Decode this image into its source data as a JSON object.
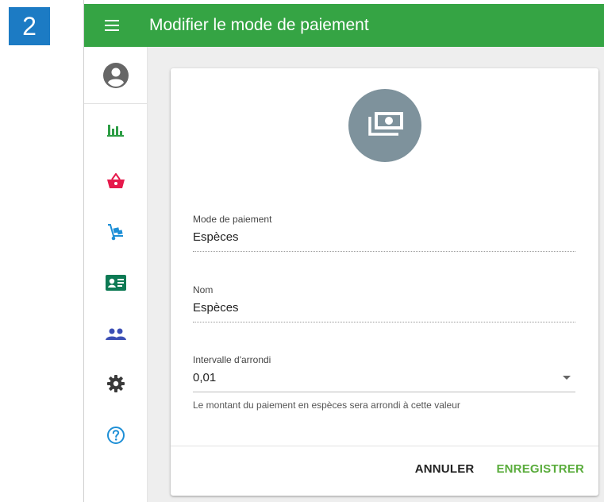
{
  "step": "2",
  "header": {
    "title": "Modifier le mode de paiement"
  },
  "icons": {
    "menu": "menu-icon",
    "profile": "account-circle-icon",
    "nav": [
      "bar-chart-icon",
      "shopping-basket-icon",
      "hand-truck-icon",
      "contact-card-icon",
      "people-icon",
      "gear-icon",
      "help-circle-icon"
    ],
    "payment": "cash-multiple-icon"
  },
  "colors": {
    "topbar": "#35a444",
    "badge": "#1c7bc4",
    "nav": [
      "#2e9e46",
      "#e6194b",
      "#1e8fd6",
      "#0d7a54",
      "#3c4fb5",
      "#3a3a3a",
      "#1e8fd6"
    ],
    "save": "#5aac3c"
  },
  "form": {
    "mode": {
      "label": "Mode de paiement",
      "value": "Espèces"
    },
    "name": {
      "label": "Nom",
      "value": "Espèces"
    },
    "rounding": {
      "label": "Intervalle d'arrondi",
      "value": "0,01",
      "hint": "Le montant du paiement en espèces sera arrondi à cette valeur"
    }
  },
  "actions": {
    "cancel": "ANNULER",
    "save": "ENREGISTRER"
  }
}
